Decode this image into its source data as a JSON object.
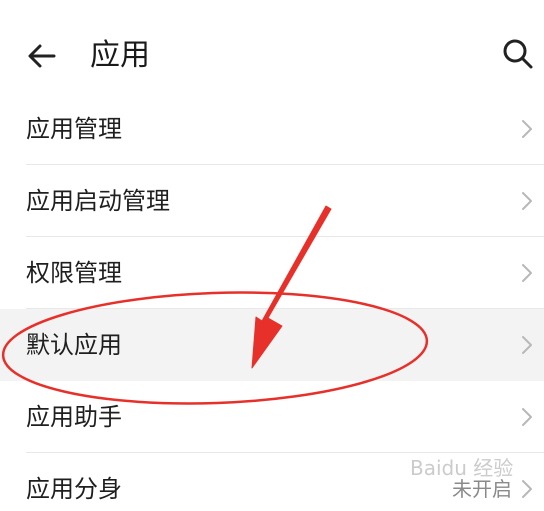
{
  "header": {
    "title": "应用",
    "back_icon": "arrow-left-icon",
    "search_icon": "search-icon"
  },
  "list": {
    "items": [
      {
        "label": "应用管理",
        "value": ""
      },
      {
        "label": "应用启动管理",
        "value": ""
      },
      {
        "label": "权限管理",
        "value": ""
      },
      {
        "label": "默认应用",
        "value": ""
      },
      {
        "label": "应用助手",
        "value": ""
      },
      {
        "label": "应用分身",
        "value": "未开启"
      }
    ]
  },
  "annotation": {
    "color": "#e8302a"
  },
  "watermark": {
    "text": "Baidu 经验"
  }
}
